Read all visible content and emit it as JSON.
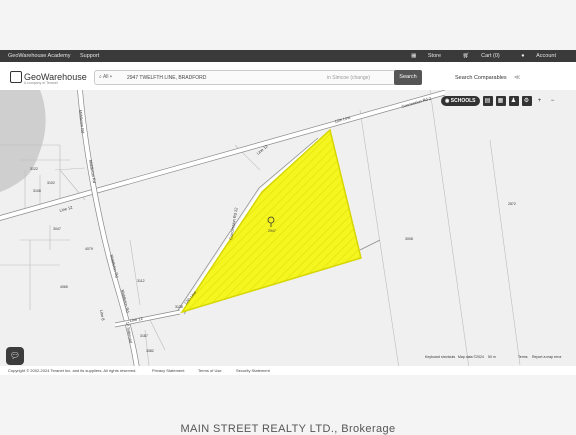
{
  "topbar": {
    "academy": "GeoWarehouse Academy",
    "support": "Support",
    "store": "Store",
    "cart": "Cart (0)",
    "account": "Account"
  },
  "header": {
    "logo": "GeoWarehouse",
    "logo_sub": "A company of Teranet",
    "search_scope": "All",
    "search_value": "2947 TWELFTH LINE, BRADFORD",
    "search_scope_hint": "in Simcoe (change)",
    "search_button": "Search",
    "search_comparables": "Search Comparables"
  },
  "map_controls": {
    "schools": "SCHOOLS"
  },
  "map_labels": {
    "road_concession_top": "Concession Rd 2",
    "road_12th_line_top": "12th Line",
    "road_line_12": "Line 12",
    "road_line12_left": "Line 12",
    "road_concession_rd_12": "Concession Rd 12",
    "road_12th_line_bottom": "12th Line",
    "road_line_12_bottom": "Line 12",
    "road_middleton_1": "Middleton Rd",
    "road_middleton_2": "Middleton Rd",
    "road_middleton_3": "Middleton Rd",
    "road_middleton_4": "Middleton Rd",
    "road_10_sideroad": "10 Sideroad",
    "road_line_8": "Line 8",
    "parcel_2947": "2947",
    "parcel_3008": "3008",
    "parcel_2872": "2872",
    "parcel_3122": "3122",
    "parcel_3108": "3108",
    "parcel_3102": "3102",
    "parcel_3047": "3047",
    "parcel_4079": "4079",
    "parcel_4065": "4065",
    "parcel_3112": "3112",
    "parcel_3187": "3187",
    "parcel_3082": "3082",
    "parcel_3138": "3138"
  },
  "attribution": {
    "shortcuts": "Keyboard shortcuts",
    "mapdata": "Map data ©2024",
    "scale": "50 m",
    "terms": "Terms",
    "report": "Report a map error"
  },
  "footer": {
    "copyright": "Copyright © 2002-2024 Teranet Inc. and its suppliers. All rights reserved.",
    "privacy": "Privacy Statement",
    "terms": "Terms of Use",
    "security": "Security Statement"
  },
  "watermark": "MAIN STREET REALTY LTD., Brokerage",
  "colors": {
    "parcel_fill": "#f5f520",
    "parcel_stroke": "#d6d600",
    "road": "#ffffff",
    "topbar": "#3a3a3a",
    "map_bg": "#f0f0f0"
  }
}
